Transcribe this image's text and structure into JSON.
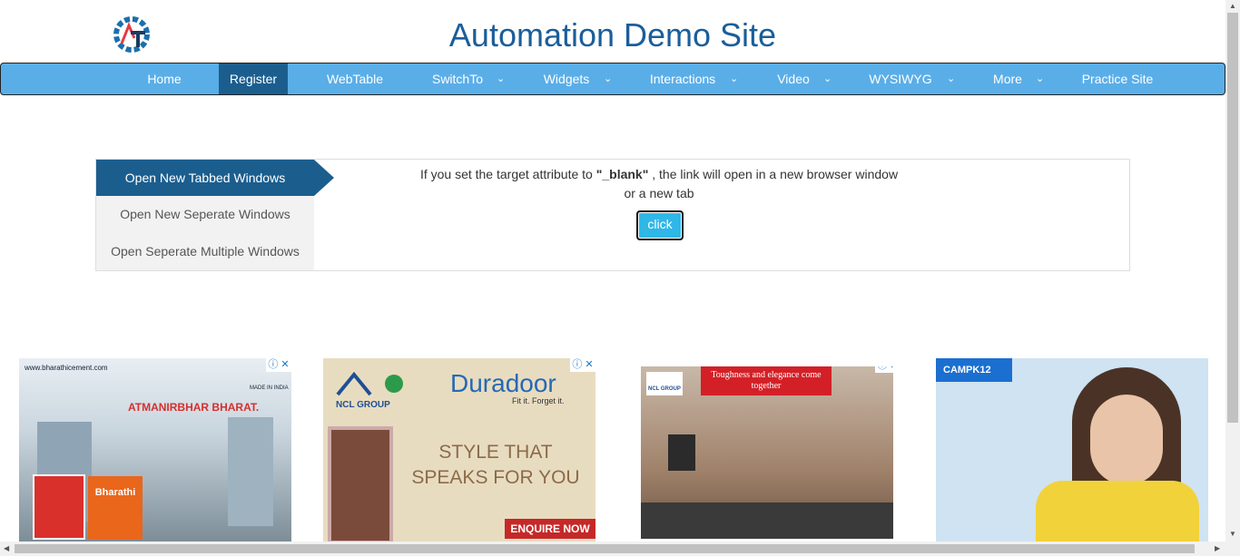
{
  "header": {
    "title": "Automation Demo Site"
  },
  "nav": {
    "items": [
      {
        "label": "Home"
      },
      {
        "label": "Register"
      },
      {
        "label": "WebTable"
      },
      {
        "label": "SwitchTo"
      },
      {
        "label": "Widgets"
      },
      {
        "label": "Interactions"
      },
      {
        "label": "Video"
      },
      {
        "label": "WYSIWYG"
      },
      {
        "label": "More"
      },
      {
        "label": "Practice Site"
      }
    ],
    "active": "Register"
  },
  "tabs": {
    "items": [
      {
        "label": "Open New Tabbed Windows"
      },
      {
        "label": "Open New Seperate Windows"
      },
      {
        "label": "Open Seperate Multiple Windows"
      }
    ],
    "content": {
      "text_before": "If you set the target attribute to ",
      "code": "\"_blank\"",
      "text_after": " , the link will open in a new browser window or a new tab",
      "button_label": "click"
    }
  },
  "ads": {
    "ad1": {
      "url": "www.bharathicement.com",
      "headline": "ATMANIRBHAR BHARAT.",
      "brand": "Bharathi",
      "badge": "MADE IN INDIA"
    },
    "ad2": {
      "brand": "Duradoor",
      "tagline": "Fit it. Forget it.",
      "group": "NCL GROUP",
      "headline": "STYLE THAT SPEAKS FOR YOU",
      "cta": "ENQUIRE NOW"
    },
    "ad3": {
      "group": "NCL GROUP",
      "headline": "Toughness and elegance come together"
    },
    "ad4": {
      "brand": "CAMPK12"
    }
  },
  "colors": {
    "nav_bg": "#5aaee8",
    "nav_active": "#1b5e8e",
    "title": "#1a5e9a",
    "button": "#2fb7e8"
  }
}
